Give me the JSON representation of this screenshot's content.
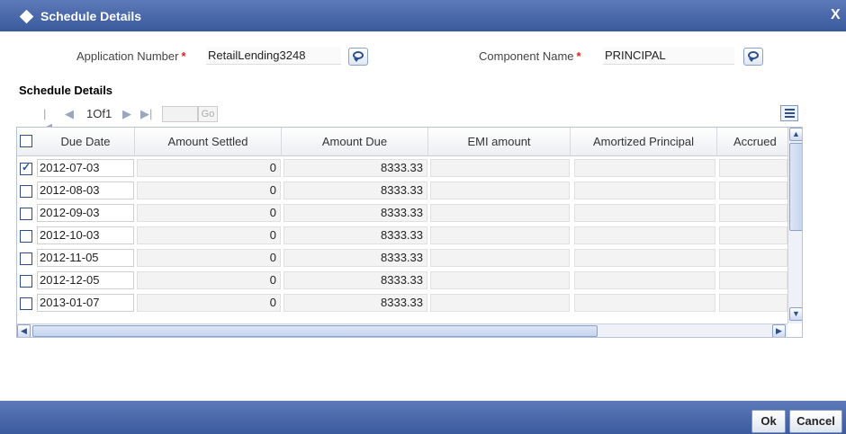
{
  "window": {
    "title": "Schedule Details",
    "close_label": "X"
  },
  "header_fields": {
    "application_number": {
      "label": "Application Number",
      "required_mark": "*",
      "value": "RetailLending3248"
    },
    "component_name": {
      "label": "Component Name",
      "required_mark": "*",
      "value": "PRINCIPAL"
    }
  },
  "section": {
    "title": "Schedule Details"
  },
  "pager": {
    "first_icon": "first-page-icon",
    "prev_icon": "prev-page-icon",
    "page_text": "1Of1",
    "next_icon": "next-page-icon",
    "last_icon": "last-page-icon",
    "goto_value": "",
    "go_label": "Go"
  },
  "table": {
    "columns": [
      "Due Date",
      "Amount Settled",
      "Amount Due",
      "EMI amount",
      "Amortized Principal",
      "Accrued"
    ],
    "rows": [
      {
        "checked": true,
        "due_date": "2012-07-03",
        "amount_settled": "0",
        "amount_due": "8333.33",
        "emi_amount": "",
        "amortized_principal": "",
        "accrued": ""
      },
      {
        "checked": false,
        "due_date": "2012-08-03",
        "amount_settled": "0",
        "amount_due": "8333.33",
        "emi_amount": "",
        "amortized_principal": "",
        "accrued": ""
      },
      {
        "checked": false,
        "due_date": "2012-09-03",
        "amount_settled": "0",
        "amount_due": "8333.33",
        "emi_amount": "",
        "amortized_principal": "",
        "accrued": ""
      },
      {
        "checked": false,
        "due_date": "2012-10-03",
        "amount_settled": "0",
        "amount_due": "8333.33",
        "emi_amount": "",
        "amortized_principal": "",
        "accrued": ""
      },
      {
        "checked": false,
        "due_date": "2012-11-05",
        "amount_settled": "0",
        "amount_due": "8333.33",
        "emi_amount": "",
        "amortized_principal": "",
        "accrued": ""
      },
      {
        "checked": false,
        "due_date": "2012-12-05",
        "amount_settled": "0",
        "amount_due": "8333.33",
        "emi_amount": "",
        "amortized_principal": "",
        "accrued": ""
      },
      {
        "checked": false,
        "due_date": "2013-01-07",
        "amount_settled": "0",
        "amount_due": "8333.33",
        "emi_amount": "",
        "amortized_principal": "",
        "accrued": ""
      }
    ]
  },
  "buttons": {
    "ok_label": "Ok",
    "cancel_label": "Cancel"
  },
  "colors": {
    "titlebar": "#3a5a9c",
    "required_asterisk": "#e02020",
    "checkbox_border": "#2d4f8f"
  }
}
